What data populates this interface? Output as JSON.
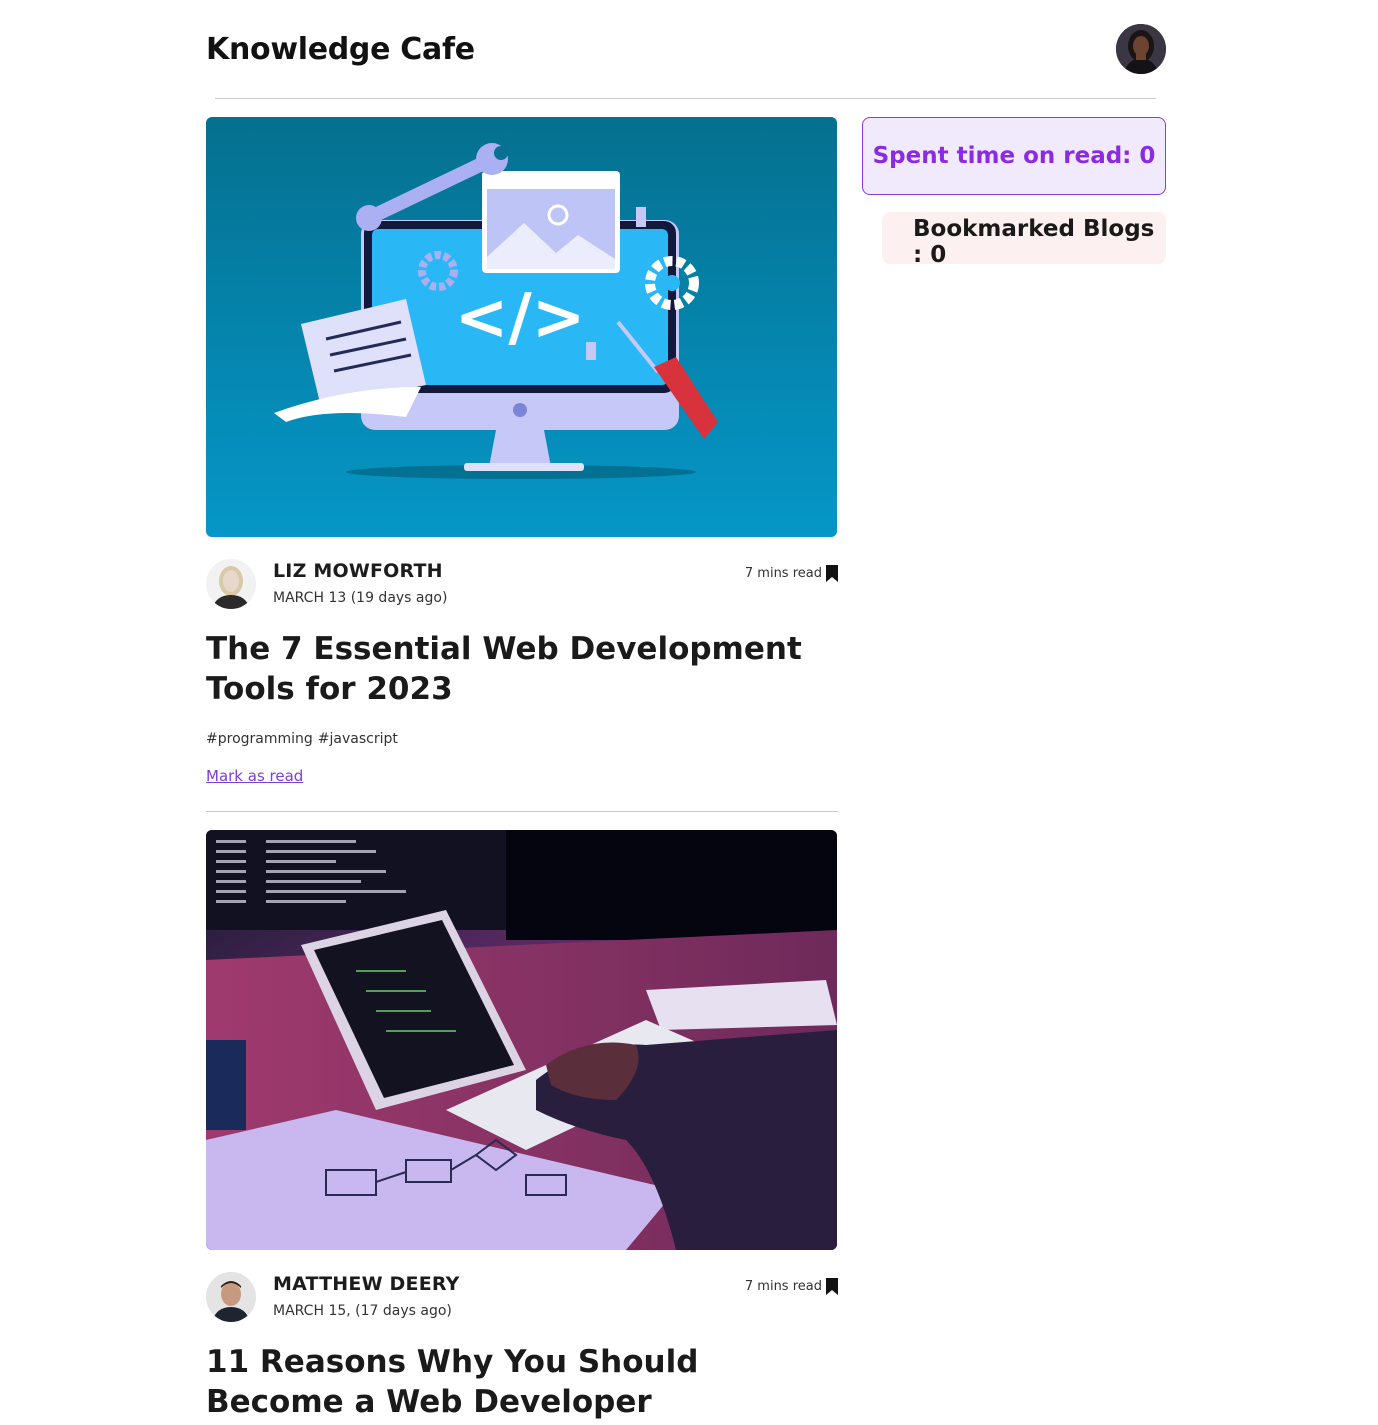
{
  "header": {
    "title": "Knowledge Cafe",
    "profile_avatar_alt": "user-avatar"
  },
  "sidebar": {
    "spent_time_label": "Spent time on read: 0",
    "bookmarked_label": "Bookmarked Blogs : 0"
  },
  "blogs": [
    {
      "author": "LIZ MOWFORTH",
      "date": "MARCH 13 (19 days ago)",
      "read_time": "7 mins read",
      "title": "The 7 Essential Web Development Tools for 2023",
      "tags": [
        "#programming",
        "#javascript"
      ],
      "mark_as_read": "Mark as read",
      "cover_icon": "web-dev-tools-illustration"
    },
    {
      "author": "MATTHEW DEERY",
      "date": "MARCH 15, (17 days ago)",
      "read_time": "7 mins read",
      "title": "11 Reasons Why You Should Become a Web Developer",
      "cover_icon": "developer-desk-photo"
    }
  ],
  "colors": {
    "accent": "#8a2be2",
    "spent_box_bg": "#f0eafc",
    "bookmarked_box_bg": "#fdf0f0",
    "link": "#7b3fd6"
  }
}
